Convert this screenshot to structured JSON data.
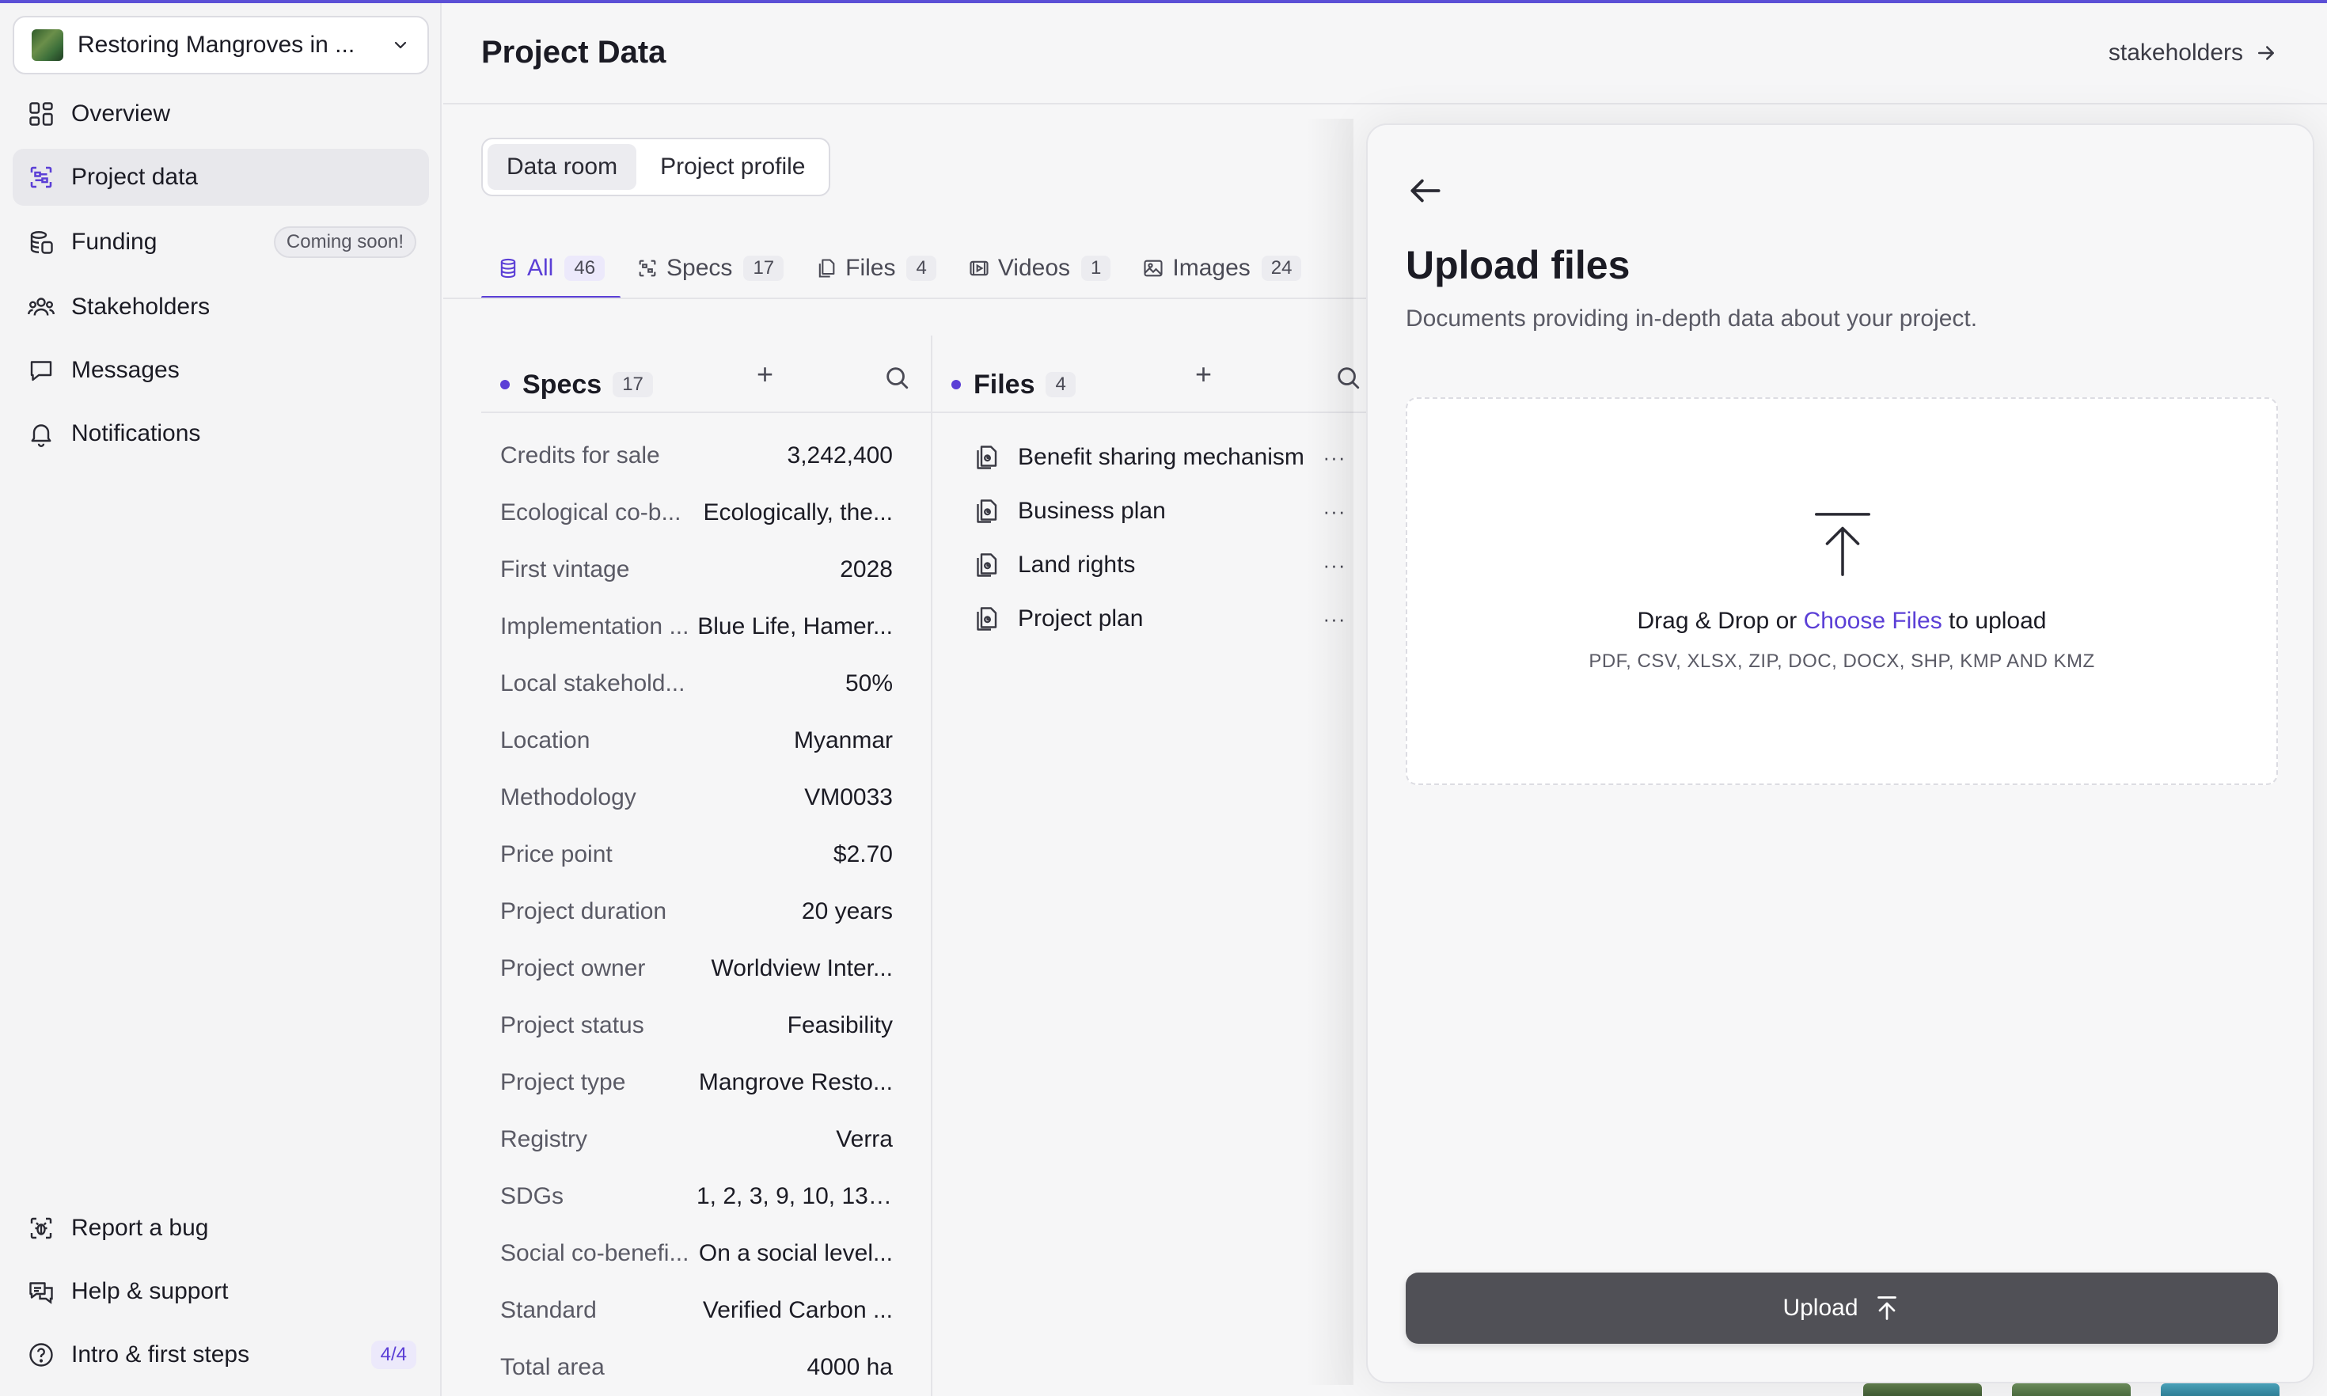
{
  "sidebar": {
    "project_name": "Restoring Mangroves in ...",
    "nav": [
      {
        "label": "Overview",
        "icon": "grid-icon"
      },
      {
        "label": "Project data",
        "icon": "data-icon"
      },
      {
        "label": "Funding",
        "icon": "coins-icon",
        "badge": "Coming soon!"
      },
      {
        "label": "Stakeholders",
        "icon": "people-icon"
      },
      {
        "label": "Messages",
        "icon": "chat-icon"
      },
      {
        "label": "Notifications",
        "icon": "bell-icon"
      }
    ],
    "footer": [
      {
        "label": "Report a bug",
        "icon": "bug-icon"
      },
      {
        "label": "Help & support",
        "icon": "support-icon"
      },
      {
        "label": "Intro & first steps",
        "icon": "help-circle-icon",
        "badge": "4/4"
      }
    ]
  },
  "header": {
    "title": "Project Data",
    "link": "stakeholders"
  },
  "segments": [
    "Data room",
    "Project profile"
  ],
  "tabs": [
    {
      "label": "All",
      "count": "46"
    },
    {
      "label": "Specs",
      "count": "17"
    },
    {
      "label": "Files",
      "count": "4"
    },
    {
      "label": "Videos",
      "count": "1"
    },
    {
      "label": "Images",
      "count": "24"
    }
  ],
  "specs": {
    "title": "Specs",
    "count": "17",
    "rows": [
      {
        "label": "Credits for sale",
        "value": "3,242,400"
      },
      {
        "label": "Ecological co-b...",
        "value": "Ecologically, the..."
      },
      {
        "label": "First vintage",
        "value": "2028"
      },
      {
        "label": "Implementation ...",
        "value": "Blue Life, Hamer..."
      },
      {
        "label": "Local stakehold...",
        "value": "50%"
      },
      {
        "label": "Location",
        "value": "Myanmar"
      },
      {
        "label": "Methodology",
        "value": "VM0033"
      },
      {
        "label": "Price point",
        "value": "$2.70"
      },
      {
        "label": "Project duration",
        "value": "20 years"
      },
      {
        "label": "Project owner",
        "value": "Worldview Inter..."
      },
      {
        "label": "Project status",
        "value": "Feasibility"
      },
      {
        "label": "Project type",
        "value": "Mangrove Resto..."
      },
      {
        "label": "Registry",
        "value": "Verra"
      },
      {
        "label": "SDGs",
        "value": "1, 2, 3, 9, 10, 13, ..."
      },
      {
        "label": "Social co-benefi...",
        "value": "On a social level..."
      },
      {
        "label": "Standard",
        "value": "Verified Carbon ..."
      },
      {
        "label": "Total area",
        "value": "4000 ha"
      }
    ]
  },
  "files": {
    "title": "Files",
    "count": "4",
    "items": [
      "Benefit sharing mechanism",
      "Business plan",
      "Land rights",
      "Project plan"
    ],
    "more": "···"
  },
  "upload_panel": {
    "title": "Upload files",
    "subtitle": "Documents providing in-depth data about your project.",
    "drag_text": "Drag & Drop or",
    "choose_link": "Choose Files",
    "after_text": "to upload",
    "formats": "PDF, CSV, XLSX, ZIP, DOC, DOCX, SHP, KMP AND KMZ",
    "button": "Upload"
  },
  "colors": {
    "accent": "#5b3fd6",
    "button": "#505056"
  }
}
